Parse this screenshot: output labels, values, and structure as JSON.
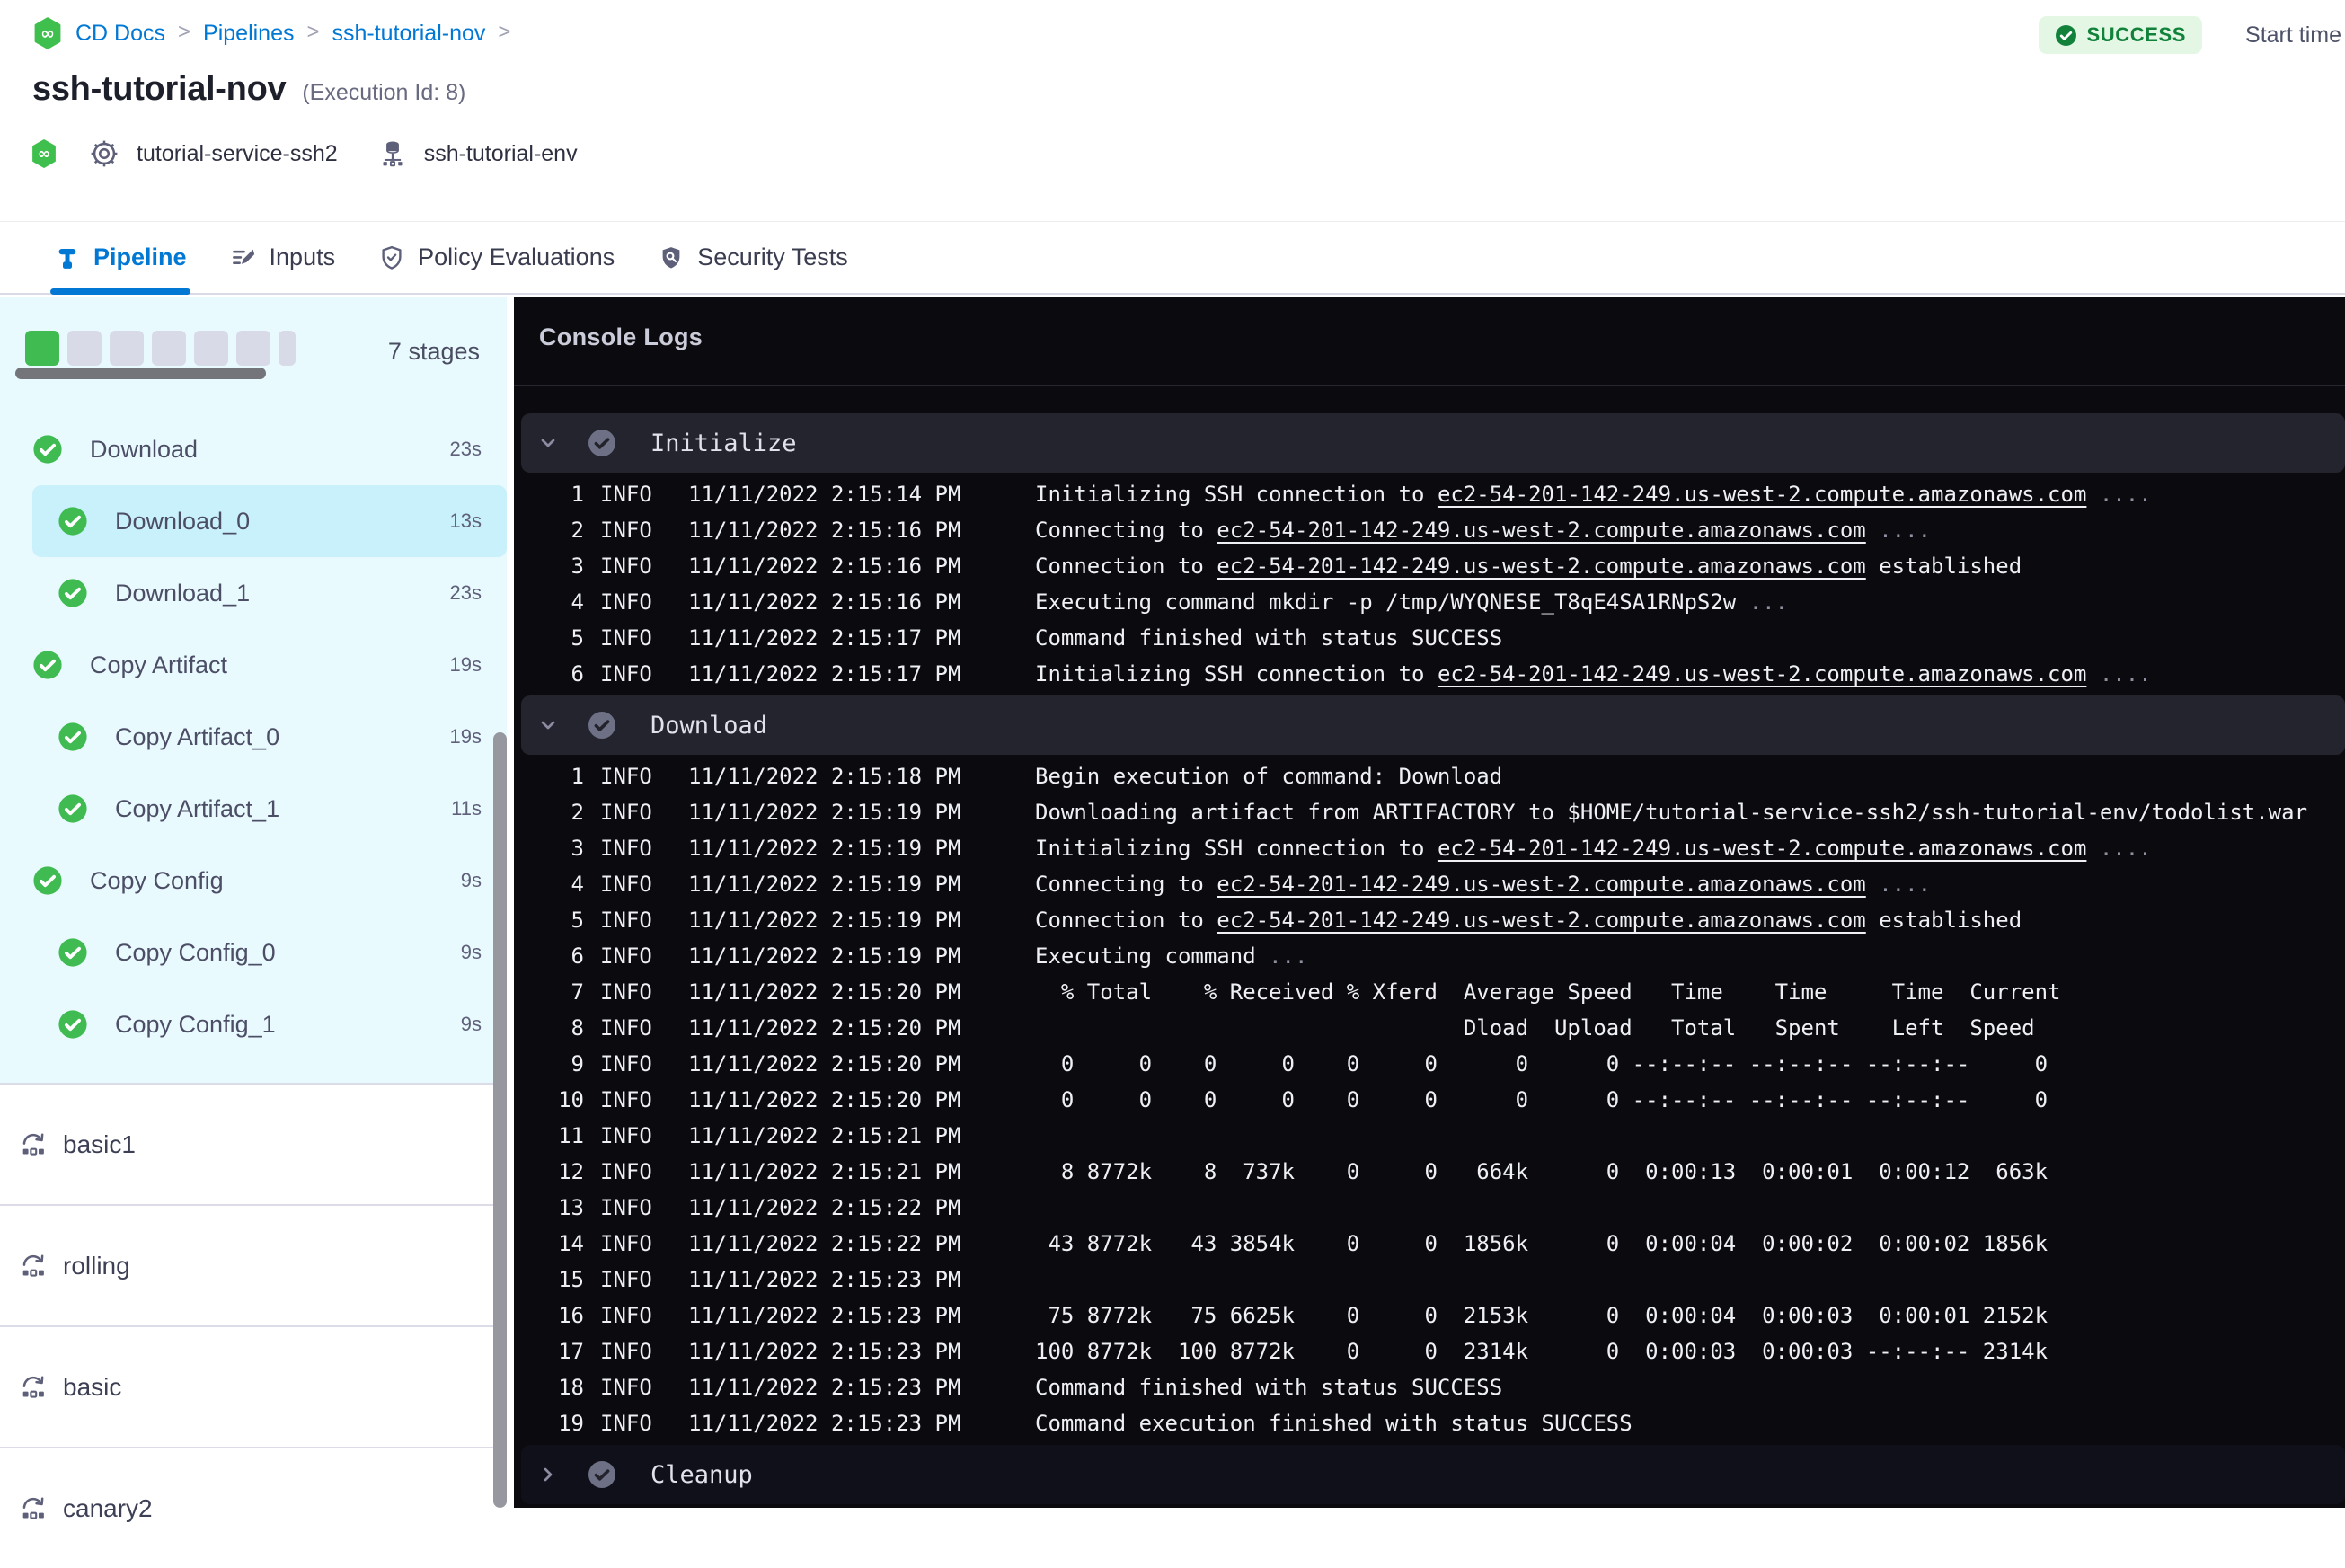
{
  "breadcrumb": {
    "items": [
      "CD Docs",
      "Pipelines",
      "ssh-tutorial-nov"
    ]
  },
  "status": {
    "label": "SUCCESS"
  },
  "header": {
    "title": "ssh-tutorial-nov",
    "execution_id": "(Execution Id: 8)",
    "service": "tutorial-service-ssh2",
    "environment": "ssh-tutorial-env",
    "start_time_label": "Start time"
  },
  "tabs": [
    {
      "id": "pipeline",
      "label": "Pipeline",
      "active": true
    },
    {
      "id": "inputs",
      "label": "Inputs",
      "active": false
    },
    {
      "id": "policy",
      "label": "Policy Evaluations",
      "active": false
    },
    {
      "id": "security",
      "label": "Security Tests",
      "active": false
    }
  ],
  "sidebar": {
    "stages_count_label": "7 stages",
    "progress": {
      "total": 7,
      "completed": 1,
      "last_partial": true
    },
    "stages": [
      {
        "name": "Download",
        "duration": "23s",
        "child": false,
        "selected": false,
        "status": "success"
      },
      {
        "name": "Download_0",
        "duration": "13s",
        "child": true,
        "selected": true,
        "status": "success"
      },
      {
        "name": "Download_1",
        "duration": "23s",
        "child": true,
        "selected": false,
        "status": "success"
      },
      {
        "name": "Copy Artifact",
        "duration": "19s",
        "child": false,
        "selected": false,
        "status": "success"
      },
      {
        "name": "Copy Artifact_0",
        "duration": "19s",
        "child": true,
        "selected": false,
        "status": "success"
      },
      {
        "name": "Copy Artifact_1",
        "duration": "11s",
        "child": true,
        "selected": false,
        "status": "success"
      },
      {
        "name": "Copy Config",
        "duration": "9s",
        "child": false,
        "selected": false,
        "status": "success"
      },
      {
        "name": "Copy Config_0",
        "duration": "9s",
        "child": true,
        "selected": false,
        "status": "success"
      },
      {
        "name": "Copy Config_1",
        "duration": "9s",
        "child": true,
        "selected": false,
        "status": "success"
      }
    ],
    "executions": [
      "basic1",
      "rolling",
      "basic",
      "canary2"
    ]
  },
  "console": {
    "title": "Console Logs",
    "sections": [
      {
        "name": "Initialize",
        "expanded": true,
        "status": "success",
        "lines": [
          {
            "n": 1,
            "level": "INFO",
            "time": "11/11/2022 2:15:14 PM",
            "msg": [
              {
                "t": "Initializing SSH connection to "
              },
              {
                "t": "ec2-54-201-142-249.us-west-2.compute.amazonaws.com",
                "k": "link"
              },
              {
                "t": " ....",
                "k": "dim"
              }
            ]
          },
          {
            "n": 2,
            "level": "INFO",
            "time": "11/11/2022 2:15:16 PM",
            "msg": [
              {
                "t": "Connecting to "
              },
              {
                "t": "ec2-54-201-142-249.us-west-2.compute.amazonaws.com",
                "k": "link"
              },
              {
                "t": " ....",
                "k": "dim"
              }
            ]
          },
          {
            "n": 3,
            "level": "INFO",
            "time": "11/11/2022 2:15:16 PM",
            "msg": [
              {
                "t": "Connection to "
              },
              {
                "t": "ec2-54-201-142-249.us-west-2.compute.amazonaws.com",
                "k": "link"
              },
              {
                "t": " established"
              }
            ]
          },
          {
            "n": 4,
            "level": "INFO",
            "time": "11/11/2022 2:15:16 PM",
            "msg": [
              {
                "t": "Executing command mkdir -p /tmp/WYQNESE_T8qE4SA1RNpS2w "
              },
              {
                "t": "...",
                "k": "dim"
              }
            ]
          },
          {
            "n": 5,
            "level": "INFO",
            "time": "11/11/2022 2:15:17 PM",
            "msg": [
              {
                "t": "Command finished with status SUCCESS"
              }
            ]
          },
          {
            "n": 6,
            "level": "INFO",
            "time": "11/11/2022 2:15:17 PM",
            "msg": [
              {
                "t": "Initializing SSH connection to "
              },
              {
                "t": "ec2-54-201-142-249.us-west-2.compute.amazonaws.com",
                "k": "link"
              },
              {
                "t": " ....",
                "k": "dim"
              }
            ]
          }
        ]
      },
      {
        "name": "Download",
        "expanded": true,
        "status": "success",
        "lines": [
          {
            "n": 1,
            "level": "INFO",
            "time": "11/11/2022 2:15:18 PM",
            "msg": [
              {
                "t": "Begin execution of command: Download"
              }
            ]
          },
          {
            "n": 2,
            "level": "INFO",
            "time": "11/11/2022 2:15:19 PM",
            "msg": [
              {
                "t": "Downloading artifact from ARTIFACTORY to $HOME/tutorial-service-ssh2/ssh-tutorial-env/todolist.war"
              }
            ]
          },
          {
            "n": 3,
            "level": "INFO",
            "time": "11/11/2022 2:15:19 PM",
            "msg": [
              {
                "t": "Initializing SSH connection to "
              },
              {
                "t": "ec2-54-201-142-249.us-west-2.compute.amazonaws.com",
                "k": "link"
              },
              {
                "t": " ....",
                "k": "dim"
              }
            ]
          },
          {
            "n": 4,
            "level": "INFO",
            "time": "11/11/2022 2:15:19 PM",
            "msg": [
              {
                "t": "Connecting to "
              },
              {
                "t": "ec2-54-201-142-249.us-west-2.compute.amazonaws.com",
                "k": "link"
              },
              {
                "t": " ....",
                "k": "dim"
              }
            ]
          },
          {
            "n": 5,
            "level": "INFO",
            "time": "11/11/2022 2:15:19 PM",
            "msg": [
              {
                "t": "Connection to "
              },
              {
                "t": "ec2-54-201-142-249.us-west-2.compute.amazonaws.com",
                "k": "link"
              },
              {
                "t": " established"
              }
            ]
          },
          {
            "n": 6,
            "level": "INFO",
            "time": "11/11/2022 2:15:19 PM",
            "msg": [
              {
                "t": "Executing command "
              },
              {
                "t": "...",
                "k": "dim"
              }
            ]
          },
          {
            "n": 7,
            "level": "INFO",
            "time": "11/11/2022 2:15:20 PM",
            "msg": [
              {
                "t": "  % Total    % Received % Xferd  Average Speed   Time    Time     Time  Current"
              }
            ]
          },
          {
            "n": 8,
            "level": "INFO",
            "time": "11/11/2022 2:15:20 PM",
            "msg": [
              {
                "t": "                                 Dload  Upload   Total   Spent    Left  Speed"
              }
            ]
          },
          {
            "n": 9,
            "level": "INFO",
            "time": "11/11/2022 2:15:20 PM",
            "msg": [
              {
                "t": "  0     0    0     0    0     0      0      0 --:--:-- --:--:-- --:--:--     0"
              }
            ]
          },
          {
            "n": 10,
            "level": "INFO",
            "time": "11/11/2022 2:15:20 PM",
            "msg": [
              {
                "t": "  0     0    0     0    0     0      0      0 --:--:-- --:--:-- --:--:--     0"
              }
            ]
          },
          {
            "n": 11,
            "level": "INFO",
            "time": "11/11/2022 2:15:21 PM",
            "msg": []
          },
          {
            "n": 12,
            "level": "INFO",
            "time": "11/11/2022 2:15:21 PM",
            "msg": [
              {
                "t": "  8 8772k    8  737k    0     0   664k      0  0:00:13  0:00:01  0:00:12  663k"
              }
            ]
          },
          {
            "n": 13,
            "level": "INFO",
            "time": "11/11/2022 2:15:22 PM",
            "msg": []
          },
          {
            "n": 14,
            "level": "INFO",
            "time": "11/11/2022 2:15:22 PM",
            "msg": [
              {
                "t": " 43 8772k   43 3854k    0     0  1856k      0  0:00:04  0:00:02  0:00:02 1856k"
              }
            ]
          },
          {
            "n": 15,
            "level": "INFO",
            "time": "11/11/2022 2:15:23 PM",
            "msg": []
          },
          {
            "n": 16,
            "level": "INFO",
            "time": "11/11/2022 2:15:23 PM",
            "msg": [
              {
                "t": " 75 8772k   75 6625k    0     0  2153k      0  0:00:04  0:00:03  0:00:01 2152k"
              }
            ]
          },
          {
            "n": 17,
            "level": "INFO",
            "time": "11/11/2022 2:15:23 PM",
            "msg": [
              {
                "t": "100 8772k  100 8772k    0     0  2314k      0  0:00:03  0:00:03 --:--:-- 2314k"
              }
            ]
          },
          {
            "n": 18,
            "level": "INFO",
            "time": "11/11/2022 2:15:23 PM",
            "msg": [
              {
                "t": "Command finished with status SUCCESS"
              }
            ]
          },
          {
            "n": 19,
            "level": "INFO",
            "time": "11/11/2022 2:15:23 PM",
            "msg": [
              {
                "t": "Command execution finished with status SUCCESS"
              }
            ]
          }
        ]
      },
      {
        "name": "Cleanup",
        "expanded": false,
        "status": "success",
        "lines": []
      }
    ]
  },
  "colors": {
    "accent_blue": "#0278d5",
    "success_green": "#3fbb51",
    "success_badge_bg": "#e3f7e4",
    "success_badge_text": "#12823b",
    "sidebar_bg": "#e9faff",
    "selected_stage_bg": "#c9f1fc",
    "console_bg": "#0b0b0f",
    "console_section_bg": "#24242e"
  }
}
